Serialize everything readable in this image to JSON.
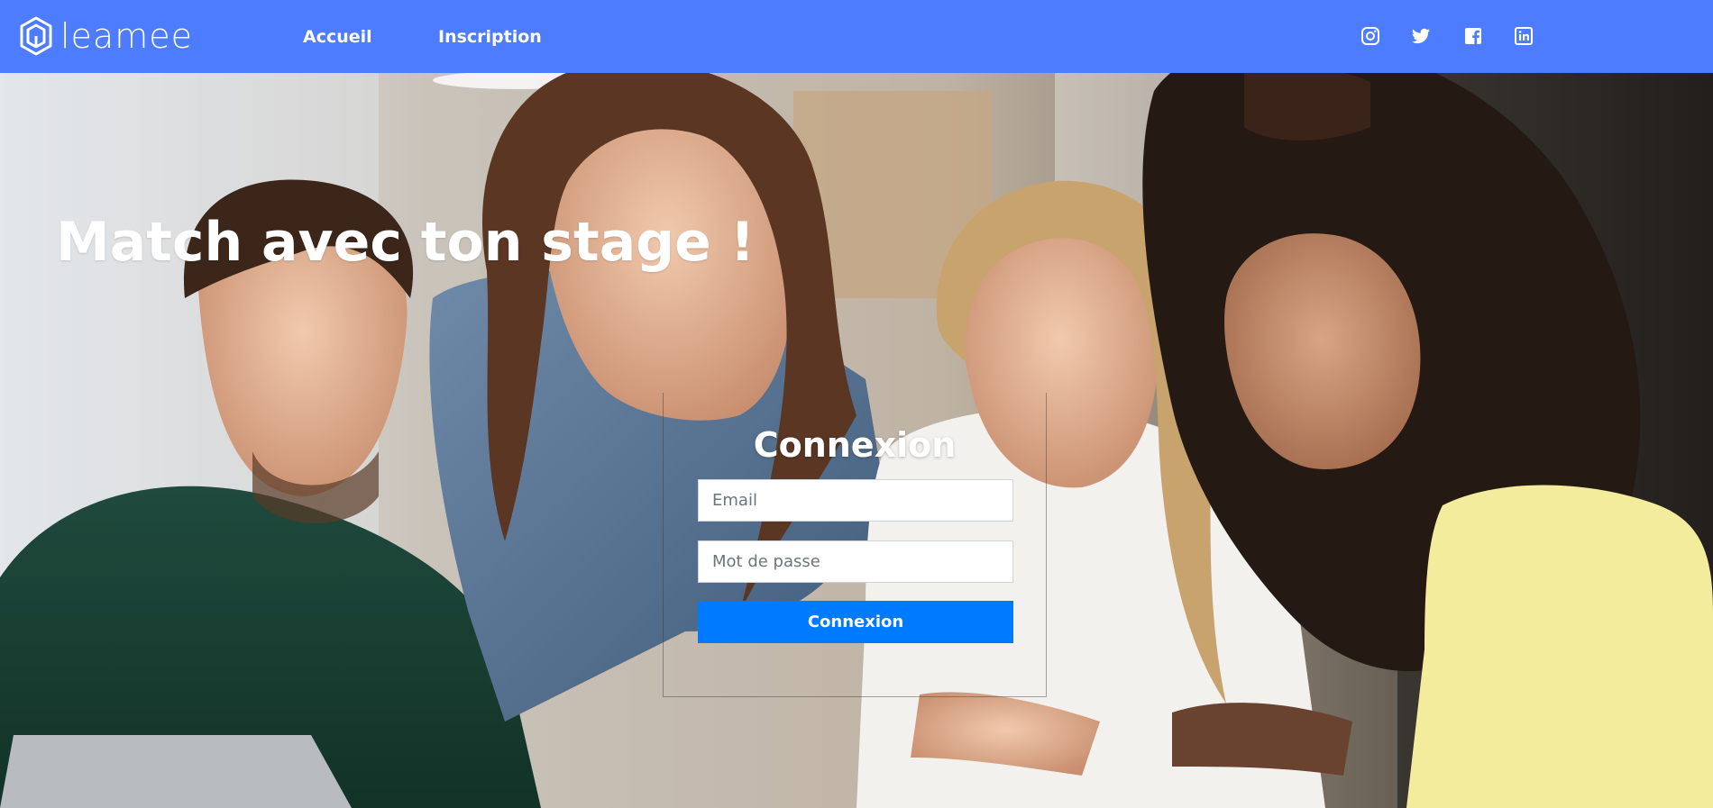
{
  "app": {
    "brand": "leamee",
    "accent_color": "#4d7cfe",
    "button_color": "#007bff"
  },
  "nav": {
    "links": [
      {
        "label": "Accueil"
      },
      {
        "label": "Inscription"
      }
    ],
    "social_icons": [
      "instagram-icon",
      "twitter-icon",
      "facebook-icon",
      "linkedin-icon"
    ]
  },
  "hero": {
    "title": "Match avec ton stage !"
  },
  "login": {
    "title": "Connexion",
    "email_placeholder": "Email",
    "email_value": "",
    "password_placeholder": "Mot de passe",
    "password_value": "",
    "submit_label": "Connexion"
  }
}
